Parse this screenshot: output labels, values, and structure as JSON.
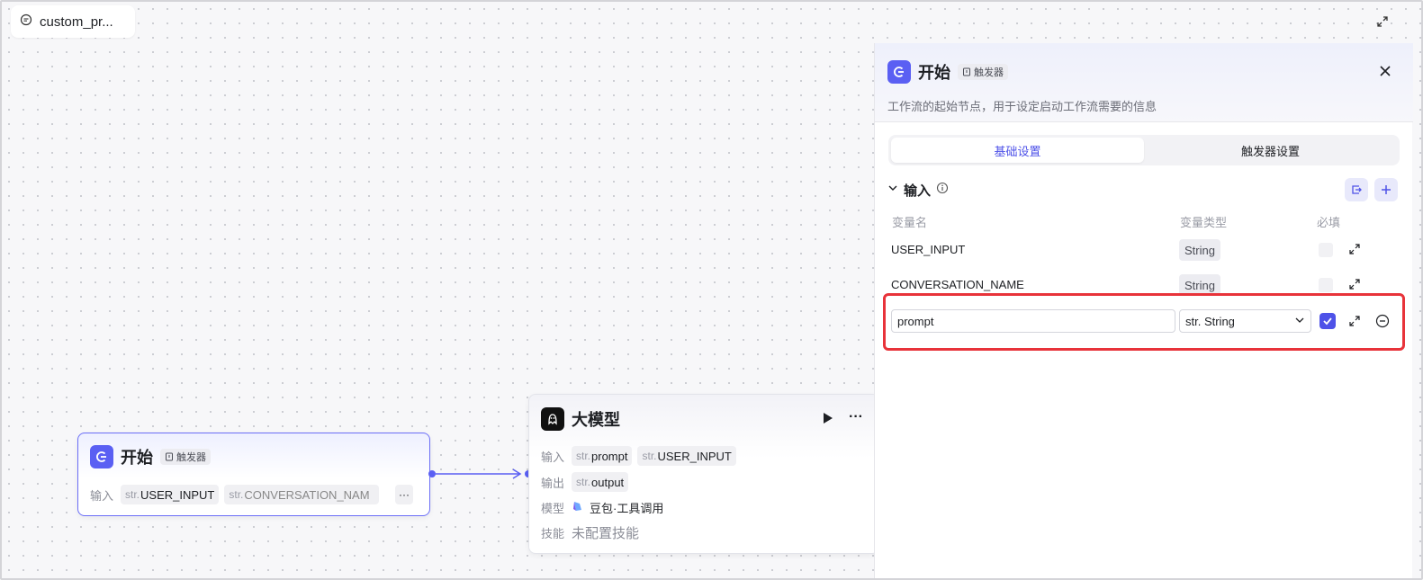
{
  "tab": {
    "title": "custom_pr..."
  },
  "canvas": {
    "start_node": {
      "title": "开始",
      "trigger_tag": "触发器",
      "input_label": "输入",
      "inputs": [
        {
          "prefix": "str.",
          "name": "USER_INPUT"
        },
        {
          "prefix": "str.",
          "name": "CONVERSATION_NAM"
        }
      ],
      "more": "···"
    },
    "llm_node": {
      "title": "大模型",
      "input_label": "输入",
      "inputs": [
        {
          "prefix": "str.",
          "name": "prompt"
        },
        {
          "prefix": "str.",
          "name": "USER_INPUT"
        }
      ],
      "output_label": "输出",
      "outputs": [
        {
          "prefix": "str.",
          "name": "output"
        }
      ],
      "model_label": "模型",
      "model_value": "豆包·工具调用",
      "skill_label": "技能",
      "skill_value": "未配置技能",
      "more": "···"
    }
  },
  "panel": {
    "title": "开始",
    "trigger_tag": "触发器",
    "description": "工作流的起始节点，用于设定启动工作流需要的信息",
    "tabs": [
      {
        "label": "基础设置",
        "active": true
      },
      {
        "label": "触发器设置",
        "active": false
      }
    ],
    "section_title": "输入",
    "columns": {
      "name": "变量名",
      "type": "变量类型",
      "required": "必填"
    },
    "variables": [
      {
        "name": "USER_INPUT",
        "type": "String"
      },
      {
        "name": "CONVERSATION_NAME",
        "type": "String"
      }
    ],
    "editing": {
      "name_value": "prompt",
      "type_value": "str. String",
      "required": true
    }
  },
  "colors": {
    "accent": "#5a5ff3",
    "highlight": "#e8333a"
  }
}
